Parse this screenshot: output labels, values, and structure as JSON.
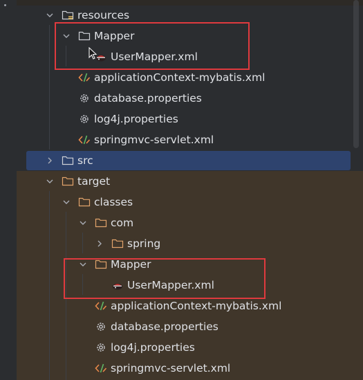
{
  "tree": {
    "resources": {
      "label": "resources",
      "icon": "resources-folder-icon"
    },
    "mapper_src": {
      "label": "Mapper",
      "icon": "folder-icon"
    },
    "usermapper_src": {
      "label": "UserMapper.xml",
      "icon": "mybatis-mapper-icon"
    },
    "appctx_src": {
      "label": "applicationContext-mybatis.xml",
      "icon": "xml-file-icon"
    },
    "dbprops_src": {
      "label": "database.properties",
      "icon": "settings-file-icon"
    },
    "log4j_src": {
      "label": "log4j.properties",
      "icon": "settings-file-icon"
    },
    "springmvc_src": {
      "label": "springmvc-servlet.xml",
      "icon": "xml-file-icon"
    },
    "src": {
      "label": "src",
      "icon": "folder-icon",
      "selected": true
    },
    "target": {
      "label": "target",
      "icon": "excluded-folder-icon"
    },
    "classes": {
      "label": "classes",
      "icon": "excluded-folder-icon"
    },
    "com": {
      "label": "com",
      "icon": "excluded-folder-icon"
    },
    "spring": {
      "label": "spring",
      "icon": "excluded-folder-icon"
    },
    "mapper_tgt": {
      "label": "Mapper",
      "icon": "excluded-folder-icon"
    },
    "usermapper_tgt": {
      "label": "UserMapper.xml",
      "icon": "mybatis-mapper-icon"
    },
    "appctx_tgt": {
      "label": "applicationContext-mybatis.xml",
      "icon": "xml-file-icon"
    },
    "dbprops_tgt": {
      "label": "database.properties",
      "icon": "settings-file-icon"
    },
    "log4j_tgt": {
      "label": "log4j.properties",
      "icon": "settings-file-icon"
    },
    "springmvc_tgt": {
      "label": "springmvc-servlet.xml",
      "icon": "xml-file-icon"
    }
  },
  "colors": {
    "background": "#2b2d30",
    "excluded_background": "#40362a",
    "selection": "#2e436e",
    "highlight_box": "#e03a3e",
    "text": "#dfe1e5",
    "xml_orange": "#e8894a",
    "xml_green": "#5fb865"
  }
}
